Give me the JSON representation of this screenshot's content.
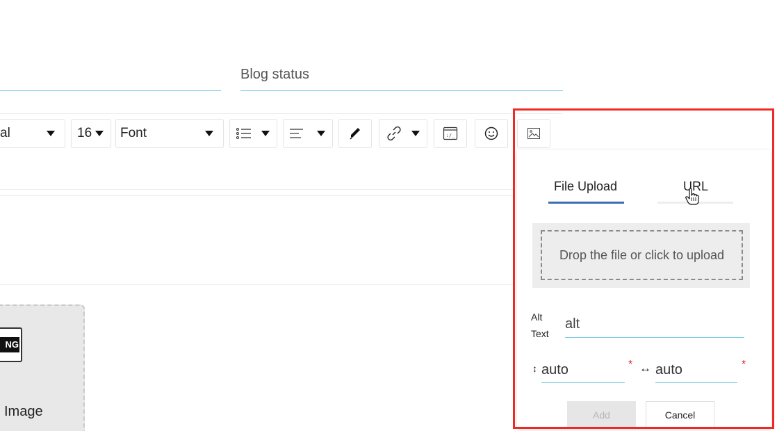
{
  "form": {
    "blog_status_label": "Blog status"
  },
  "toolbar": {
    "paragraph_style_value": "al",
    "font_size_value": "16",
    "font_family_value": "Font",
    "icons": [
      "list-icon",
      "align-icon",
      "pen-icon",
      "link-icon",
      "embed-icon",
      "emoji-icon",
      "image-icon"
    ]
  },
  "editor": {
    "image_placeholder": {
      "badge": "NG",
      "label": "Image"
    }
  },
  "image_popup": {
    "tabs": [
      {
        "label": "File Upload",
        "active": true
      },
      {
        "label": "URL",
        "active": false
      }
    ],
    "drop_text": "Drop the file or click to upload",
    "alt_label_line1": "Alt",
    "alt_label_line2": "Text",
    "alt_value": "alt",
    "height_value": "auto",
    "width_value": "auto",
    "required_mark": "*",
    "add_label": "Add",
    "cancel_label": "Cancel",
    "add_disabled": true
  },
  "colors": {
    "highlight": "#ef2a24",
    "underline": "#7ccfe0",
    "active_tab": "#3b6cb5",
    "required": "#e3242b"
  }
}
